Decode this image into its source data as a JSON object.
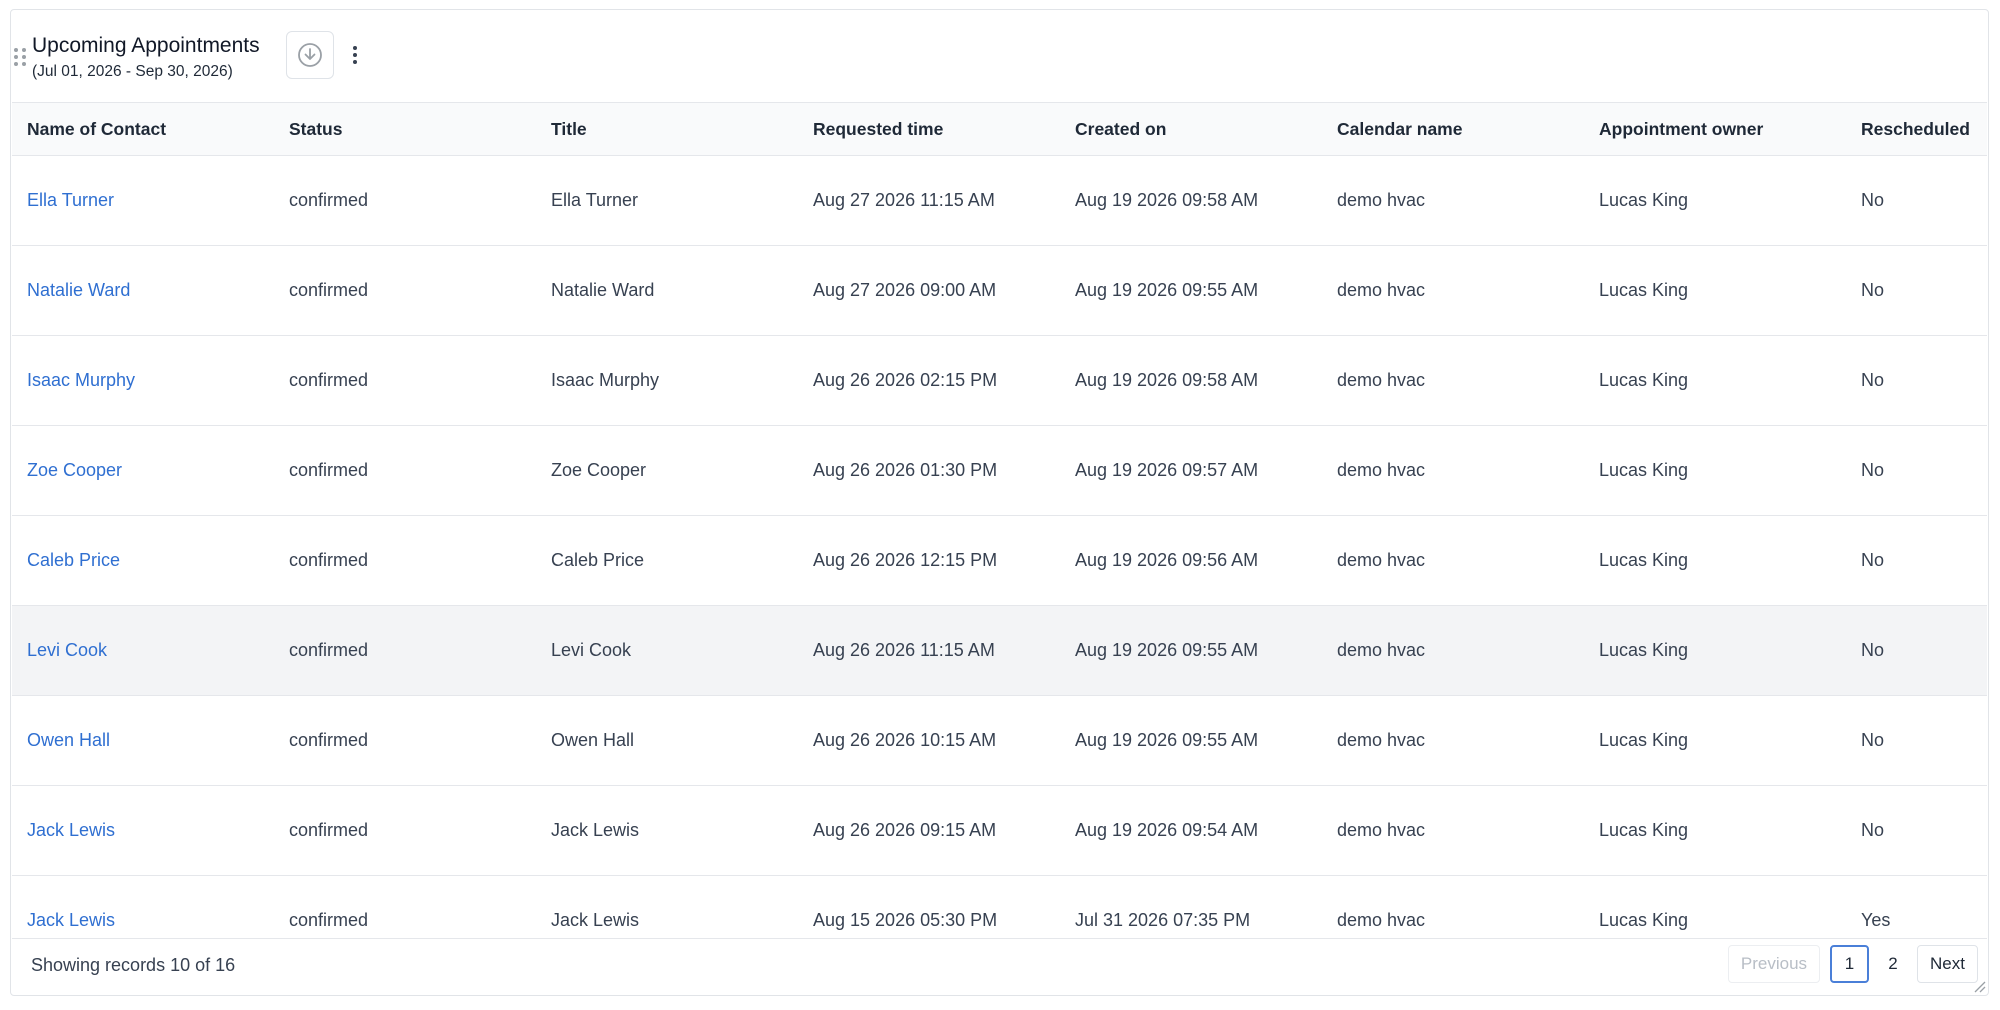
{
  "widget": {
    "title": "Upcoming Appointments",
    "date_range": "(Jul 01, 2026 - Sep 30, 2026)",
    "download_icon": "download-circle-icon",
    "more_icon": "more-vertical-icon"
  },
  "table": {
    "columns": [
      "Name of Contact",
      "Status",
      "Title",
      "Requested time",
      "Created on",
      "Calendar name",
      "Appointment owner",
      "Rescheduled"
    ],
    "rows": [
      {
        "name": "Ella Turner",
        "status": "confirmed",
        "title": "Ella Turner",
        "requested": "Aug 27 2026 11:15 AM",
        "created": "Aug 19 2026 09:58 AM",
        "calendar": "demo hvac",
        "owner": "Lucas King",
        "rescheduled": "No"
      },
      {
        "name": "Natalie Ward",
        "status": "confirmed",
        "title": "Natalie Ward",
        "requested": "Aug 27 2026 09:00 AM",
        "created": "Aug 19 2026 09:55 AM",
        "calendar": "demo hvac",
        "owner": "Lucas King",
        "rescheduled": "No"
      },
      {
        "name": "Isaac Murphy",
        "status": "confirmed",
        "title": "Isaac Murphy",
        "requested": "Aug 26 2026 02:15 PM",
        "created": "Aug 19 2026 09:58 AM",
        "calendar": "demo hvac",
        "owner": "Lucas King",
        "rescheduled": "No"
      },
      {
        "name": "Zoe Cooper",
        "status": "confirmed",
        "title": "Zoe Cooper",
        "requested": "Aug 26 2026 01:30 PM",
        "created": "Aug 19 2026 09:57 AM",
        "calendar": "demo hvac",
        "owner": "Lucas King",
        "rescheduled": "No"
      },
      {
        "name": "Caleb Price",
        "status": "confirmed",
        "title": "Caleb Price",
        "requested": "Aug 26 2026 12:15 PM",
        "created": "Aug 19 2026 09:56 AM",
        "calendar": "demo hvac",
        "owner": "Lucas King",
        "rescheduled": "No"
      },
      {
        "name": "Levi Cook",
        "status": "confirmed",
        "title": "Levi Cook",
        "requested": "Aug 26 2026 11:15 AM",
        "created": "Aug 19 2026 09:55 AM",
        "calendar": "demo hvac",
        "owner": "Lucas King",
        "rescheduled": "No"
      },
      {
        "name": "Owen Hall",
        "status": "confirmed",
        "title": "Owen Hall",
        "requested": "Aug 26 2026 10:15 AM",
        "created": "Aug 19 2026 09:55 AM",
        "calendar": "demo hvac",
        "owner": "Lucas King",
        "rescheduled": "No"
      },
      {
        "name": "Jack Lewis",
        "status": "confirmed",
        "title": "Jack Lewis",
        "requested": "Aug 26 2026 09:15 AM",
        "created": "Aug 19 2026 09:54 AM",
        "calendar": "demo hvac",
        "owner": "Lucas King",
        "rescheduled": "No"
      },
      {
        "name": "Jack Lewis",
        "status": "confirmed",
        "title": "Jack Lewis",
        "requested": "Aug 15 2026 05:30 PM",
        "created": "Jul 31 2026 07:35 PM",
        "calendar": "demo hvac",
        "owner": "Lucas King",
        "rescheduled": "Yes"
      }
    ]
  },
  "footer": {
    "records_text": "Showing records 10 of 16",
    "previous_label": "Previous",
    "pages": [
      "1",
      "2"
    ],
    "next_label": "Next"
  },
  "colors": {
    "link": "#2f6fd1",
    "active_page_border": "#4a7fd8",
    "header_bg": "#f9fafb",
    "hover_row_bg": "#f3f4f6"
  }
}
